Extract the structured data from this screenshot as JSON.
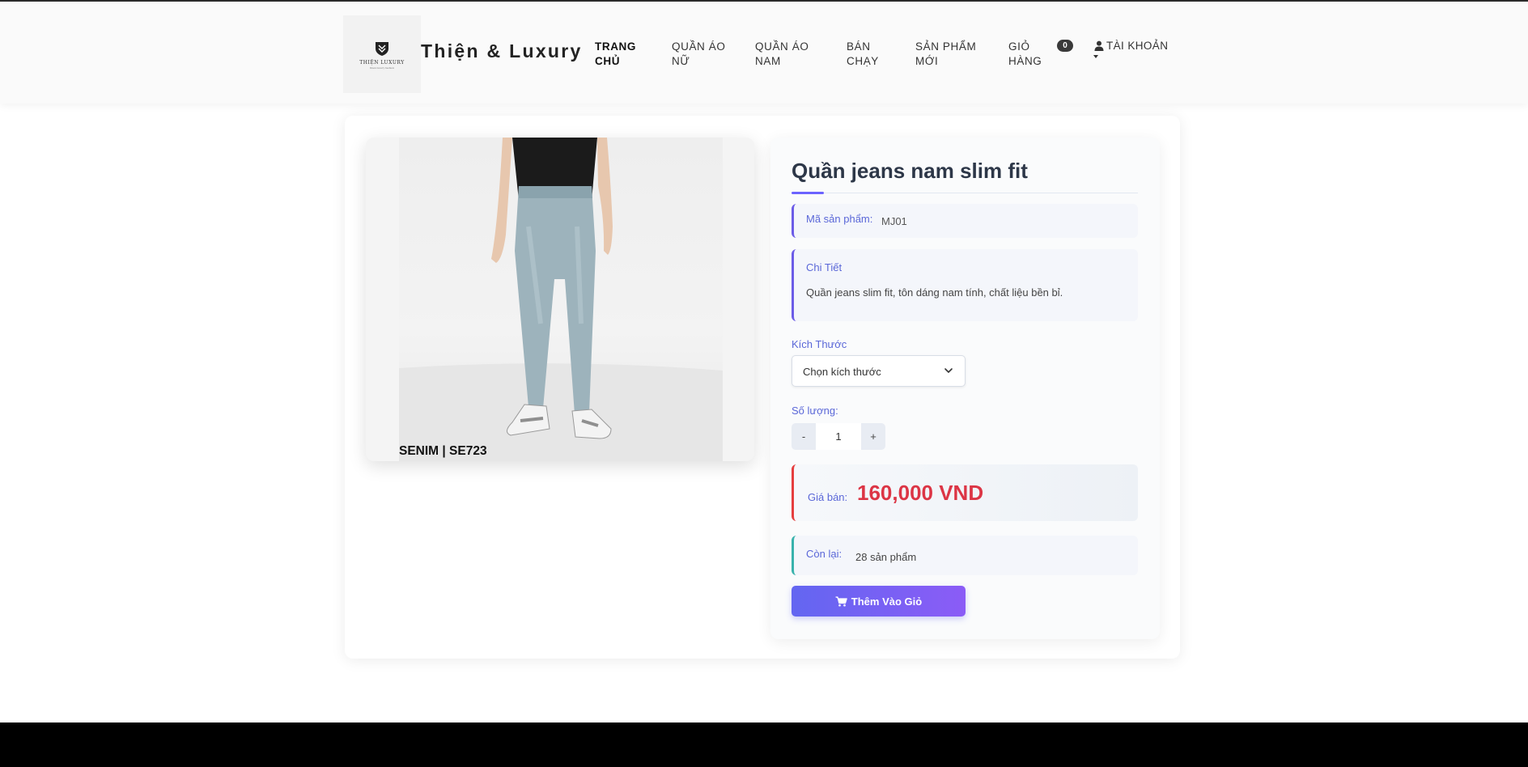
{
  "header": {
    "logo_text": "THIỆN LUXURY",
    "logo_subtext": "thien luxury fashion",
    "brand": "Thiện & Luxury",
    "nav": [
      {
        "line1": "TRANG",
        "line2": "CHỦ"
      },
      {
        "line1": "QUẦN ÁO",
        "line2": "NỮ"
      },
      {
        "line1": "QUẦN ÁO",
        "line2": "NAM"
      },
      {
        "line1": "BÁN",
        "line2": "CHẠY"
      },
      {
        "line1": "SẢN PHẨM",
        "line2": "MỚI"
      },
      {
        "line1": "GIỎ",
        "line2": "HÀNG"
      }
    ],
    "cart_count": "0",
    "account_label": "TÀI KHOẢN"
  },
  "product": {
    "image_caption": "SENIM | SE723",
    "title": "Quần jeans nam slim fit",
    "sku_label": "Mã sản phẩm:",
    "sku": "MJ01",
    "detail_label": "Chi Tiết",
    "detail_text": "Quần jeans slim fit, tôn dáng nam tính, chất liệu bền bỉ.",
    "size_label": "Kích Thước",
    "size_placeholder": "Chọn kích thước",
    "qty_label": "Số lượng:",
    "qty_minus": "-",
    "qty_value": "1",
    "qty_plus": "+",
    "price_label": "Giá bán:",
    "price": "160,000 VND",
    "stock_label": "Còn lại:",
    "stock_value": "28 sản phẩm",
    "add_to_cart": "Thêm Vào Giỏ"
  },
  "colors": {
    "accent": "#6c5ce7",
    "price": "#dc3545",
    "stock_accent": "#38b2ac",
    "button_start": "#6366f1",
    "button_end": "#8b5cf6"
  },
  "icons": [
    "logo-shield-icon",
    "user-icon",
    "account-caret-icon",
    "chevron-down-icon",
    "cart-icon"
  ]
}
